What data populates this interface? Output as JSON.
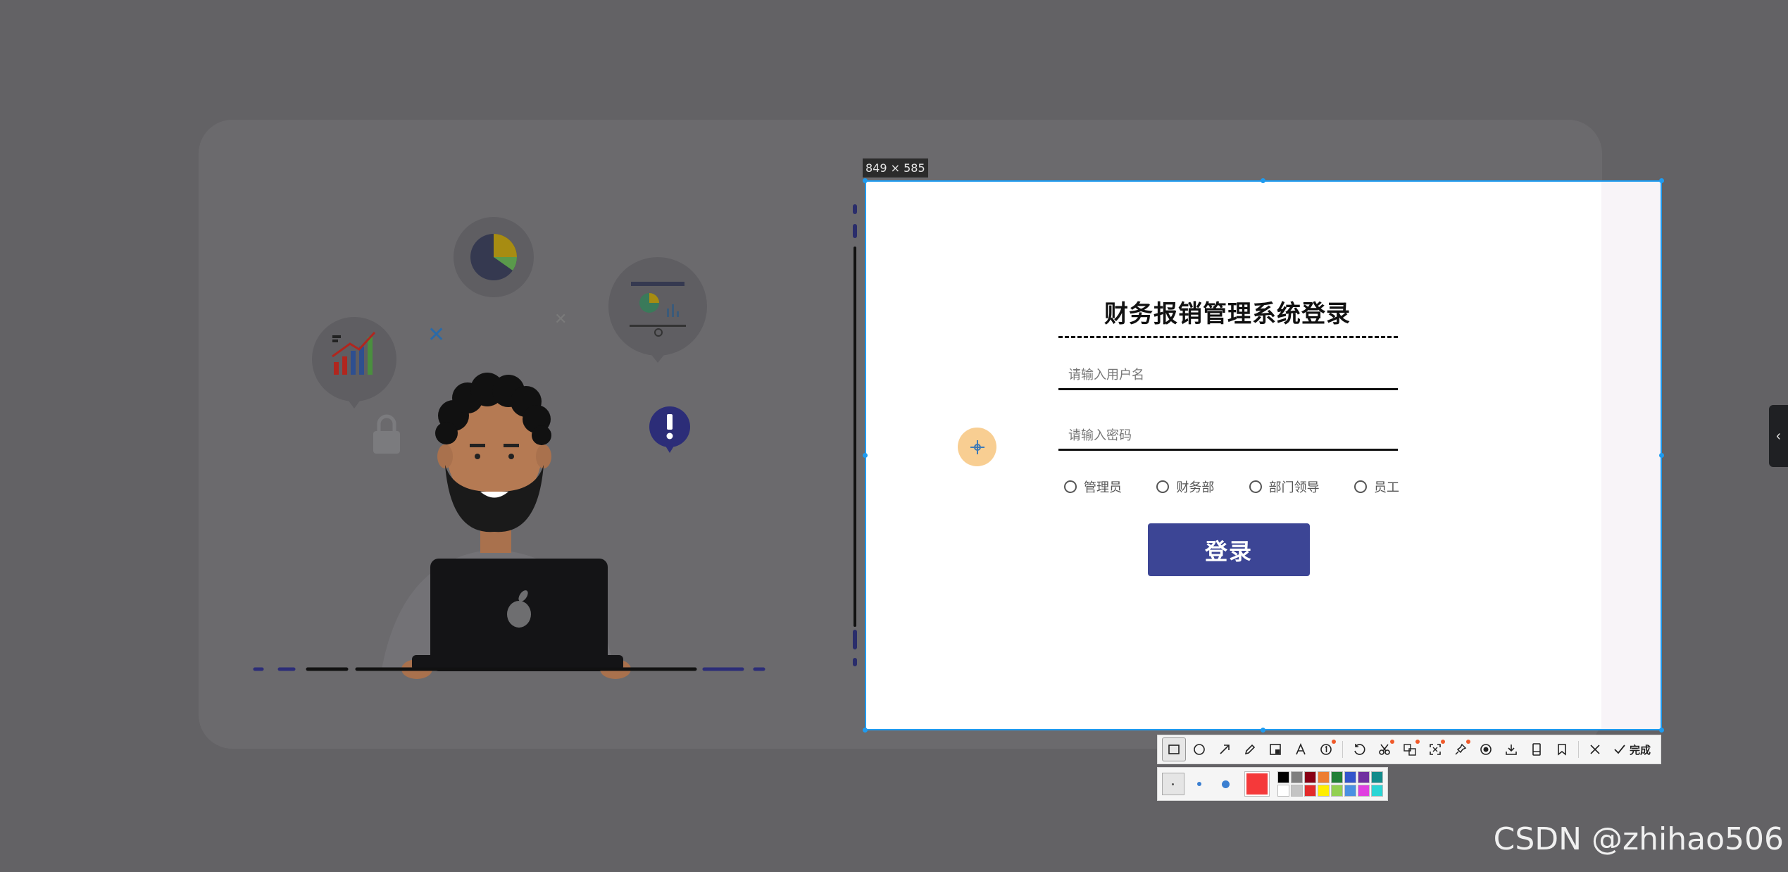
{
  "selection": {
    "size_label": "849 × 585"
  },
  "login": {
    "title": "财务报销管理系统登录",
    "username_placeholder": "请输入用户名",
    "password_placeholder": "请输入密码",
    "roles": [
      "管理员",
      "财务部",
      "部门领导",
      "员工"
    ],
    "submit_label": "登录",
    "submit_color": "#3c4595"
  },
  "toolbar": {
    "tools": [
      "rectangle-icon",
      "ellipse-icon",
      "arrow-icon",
      "pencil-icon",
      "mosaic-icon",
      "text-icon",
      "numbered-marker-icon",
      "undo-icon",
      "scissors-icon",
      "translate-icon",
      "ocr-icon",
      "pin-icon",
      "record-icon",
      "download-icon",
      "long-screenshot-icon",
      "bookmark-icon"
    ],
    "close_icon": "close-icon",
    "done_label": "完成",
    "current_color": "#f5393a",
    "palette": [
      "#000000",
      "#7f7f7f",
      "#880015",
      "#ed7d31",
      "#217f37",
      "#3355cc",
      "#7030a0",
      "#138c8c",
      "#ffffff",
      "#c3c3c3",
      "#e32b2b",
      "#ffee00",
      "#92d050",
      "#4a90e2",
      "#e040e0",
      "#2bd5d5"
    ]
  },
  "watermark": "CSDN @zhihao506"
}
